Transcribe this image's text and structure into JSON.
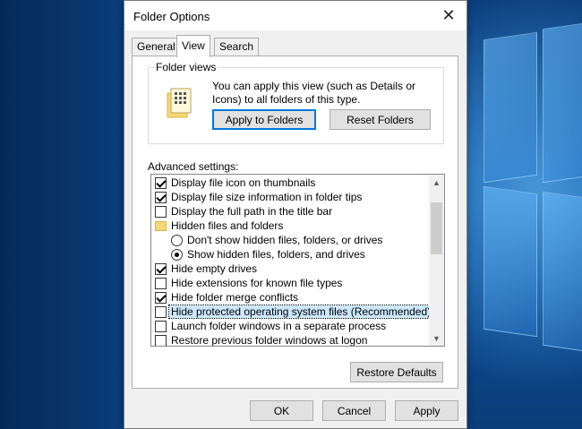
{
  "window": {
    "title": "Folder Options",
    "close_glyph": "✕"
  },
  "tabs": [
    {
      "label": "General",
      "active": false
    },
    {
      "label": "View",
      "active": true
    },
    {
      "label": "Search",
      "active": false
    }
  ],
  "folder_views": {
    "label": "Folder views",
    "description": "You can apply this view (such as Details or Icons) to all folders of this type.",
    "apply_button": "Apply to Folders",
    "reset_button": "Reset Folders"
  },
  "advanced": {
    "label": "Advanced settings:",
    "items": [
      {
        "kind": "checkbox",
        "label": "Display file icon on thumbnails",
        "checked": true,
        "indent": 0
      },
      {
        "kind": "checkbox",
        "label": "Display file size information in folder tips",
        "checked": true,
        "indent": 0
      },
      {
        "kind": "checkbox",
        "label": "Display the full path in the title bar",
        "checked": false,
        "indent": 0
      },
      {
        "kind": "folder",
        "label": "Hidden files and folders",
        "indent": 0
      },
      {
        "kind": "radio",
        "label": "Don't show hidden files, folders, or drives",
        "checked": false,
        "indent": 1
      },
      {
        "kind": "radio",
        "label": "Show hidden files, folders, and drives",
        "checked": true,
        "indent": 1
      },
      {
        "kind": "checkbox",
        "label": "Hide empty drives",
        "checked": true,
        "indent": 0
      },
      {
        "kind": "checkbox",
        "label": "Hide extensions for known file types",
        "checked": false,
        "indent": 0
      },
      {
        "kind": "checkbox",
        "label": "Hide folder merge conflicts",
        "checked": true,
        "indent": 0
      },
      {
        "kind": "checkbox",
        "label": "Hide protected operating system files (Recommended)",
        "checked": false,
        "indent": 0,
        "focused": true
      },
      {
        "kind": "checkbox",
        "label": "Launch folder windows in a separate process",
        "checked": false,
        "indent": 0
      },
      {
        "kind": "checkbox",
        "label": "Restore previous folder windows at logon",
        "checked": false,
        "indent": 0
      }
    ],
    "restore_defaults": "Restore Defaults"
  },
  "footer": {
    "ok": "OK",
    "cancel": "Cancel",
    "apply": "Apply"
  },
  "scrollbar": {
    "up_glyph": "▲",
    "down_glyph": "▼"
  },
  "colors": {
    "accent": "#0078d7",
    "selection": "#cce8ff",
    "folder": "#f5d978"
  }
}
